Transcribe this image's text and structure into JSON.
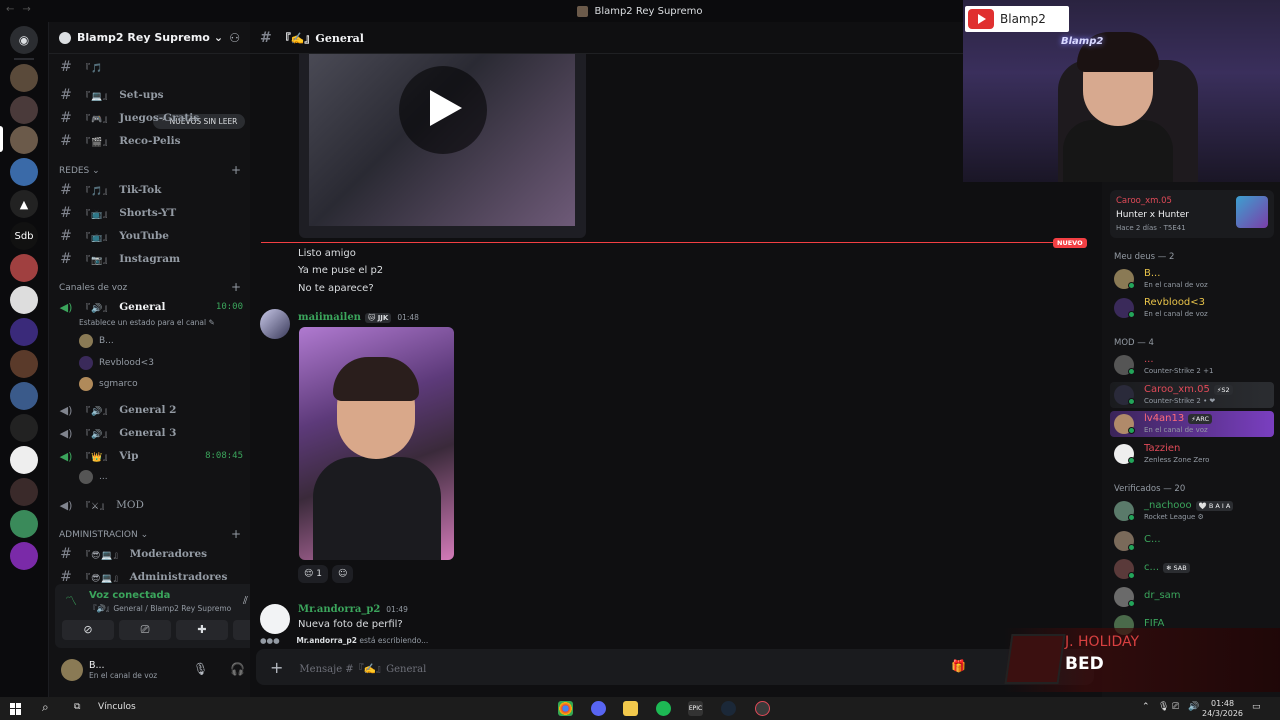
{
  "window": {
    "title": "Blamp2 Rey Supremo"
  },
  "server": {
    "name": "Blamp2 Rey Supremo",
    "dropdown": "⌄"
  },
  "unread_pill": "NUEVOS SIN LEER",
  "channels": [
    {
      "emoji": "『🎵",
      "name": ""
    },
    {
      "emoji": "『💻』",
      "name": "Set-ups"
    },
    {
      "emoji": "『🎮』",
      "name": "Juegos-Gratis"
    },
    {
      "emoji": "『🎬』",
      "name": "Reco-Pelis"
    }
  ],
  "categories": {
    "redes": "REDES",
    "voz": "Canales de voz",
    "admin": "ADMINISTRACION"
  },
  "redes_channels": [
    {
      "emoji": "『🎵』",
      "name": "Tik-Tok"
    },
    {
      "emoji": "『📺』",
      "name": "Shorts-YT"
    },
    {
      "emoji": "『📺』",
      "name": "YouTube"
    },
    {
      "emoji": "『📷』",
      "name": "Instagram"
    }
  ],
  "voice_channels": {
    "general": {
      "emoji": "『🔊』",
      "name": "General",
      "time": "10:00",
      "status": "Establece un estado para el canal ✎"
    },
    "users": [
      "B...",
      "Revblood<3",
      "sgmarco"
    ],
    "general2": {
      "emoji": "『🔊』",
      "name": "General 2"
    },
    "general3": {
      "emoji": "『🔊』",
      "name": "General 3"
    },
    "vip": {
      "emoji": "『👑』",
      "name": "Vip",
      "time": "8:08:45"
    },
    "vip_user": "...",
    "mod": {
      "emoji": "『⚔』",
      "name": "MOD"
    }
  },
  "admin_channels": [
    {
      "emoji": "『😎💻』",
      "name": "Moderadores"
    },
    {
      "emoji": "『😎💻』",
      "name": "Administradores"
    }
  ],
  "voice_panel": {
    "title": "Voz conectada",
    "subtitle": "『🔊』General / Blamp2 Rey Supremo",
    "btn_video": "⊘",
    "btn_screen": "⎚",
    "btn_activity": "✚",
    "btn_soundboard": "✦"
  },
  "user_panel": {
    "name": "B...",
    "status": "En el canal de voz"
  },
  "chat": {
    "channel_title": "『✍』General",
    "new_badge": "NUEVO",
    "messages": [
      "Listo amigo",
      "Ya me puse el p2",
      "No te aparece?"
    ],
    "author1": {
      "name": "maiimailen",
      "tag": "🐱 JJK",
      "time": "01:48"
    },
    "reaction_count": "1",
    "author2": {
      "name": "Mr.andorra_p2",
      "time": "01:49",
      "text": "Nueva foto de perfil?"
    },
    "typing_user": "Mr.andorra_p2",
    "typing_text": " está escribiendo...",
    "input_placeholder": "Mensaje #『✍』General"
  },
  "activity": {
    "user": "Caroo_xm.05",
    "title": "Hunter x Hunter",
    "meta": "Hace 2 días · T5E41"
  },
  "member_groups": {
    "g1": "Meu deus — 2",
    "g2": "MOD — 4",
    "g3": "Verificados — 20"
  },
  "members": [
    {
      "name": "B...",
      "status": "En el canal de voz",
      "color": "#e8c34a"
    },
    {
      "name": "Revblood<3",
      "status": "En el canal de voz",
      "color": "#e8c34a"
    },
    {
      "name": "...",
      "status": "Counter-Strike 2 +1",
      "color": "#f2f3f5"
    },
    {
      "name": "Caroo_xm.05",
      "tag": "⚡S2",
      "status": "Counter-Strike 2 • ❤",
      "color": "#e04a58"
    },
    {
      "name": "lv4an13",
      "tag": "⚡ARC",
      "status": "En el canal de voz",
      "color": "#e04a58"
    },
    {
      "name": "Tazzien",
      "status": "Zenless Zone Zero",
      "color": "#e04a58"
    },
    {
      "name": "_nachooo",
      "tag": "🤍 B A I A",
      "status": "Rocket League ⚙",
      "color": "#3ba55c"
    },
    {
      "name": "C...",
      "status": "",
      "color": "#3ba55c"
    },
    {
      "name": "c...",
      "tag": "❄ SAB",
      "status": "",
      "color": "#3ba55c"
    },
    {
      "name": "dr_sam",
      "status": "",
      "color": "#3ba55c"
    },
    {
      "name": "FIFA",
      "status": "",
      "color": "#3ba55c"
    }
  ],
  "stream_overlay": {
    "yt_name": "Blamp2",
    "neon_text": "Blamp2",
    "now_playing_artist": "J. HOLIDAY",
    "now_playing_song": "BED"
  },
  "taskbar": {
    "links": "Vínculos",
    "time": "01:48",
    "date": "24/3/2026"
  }
}
